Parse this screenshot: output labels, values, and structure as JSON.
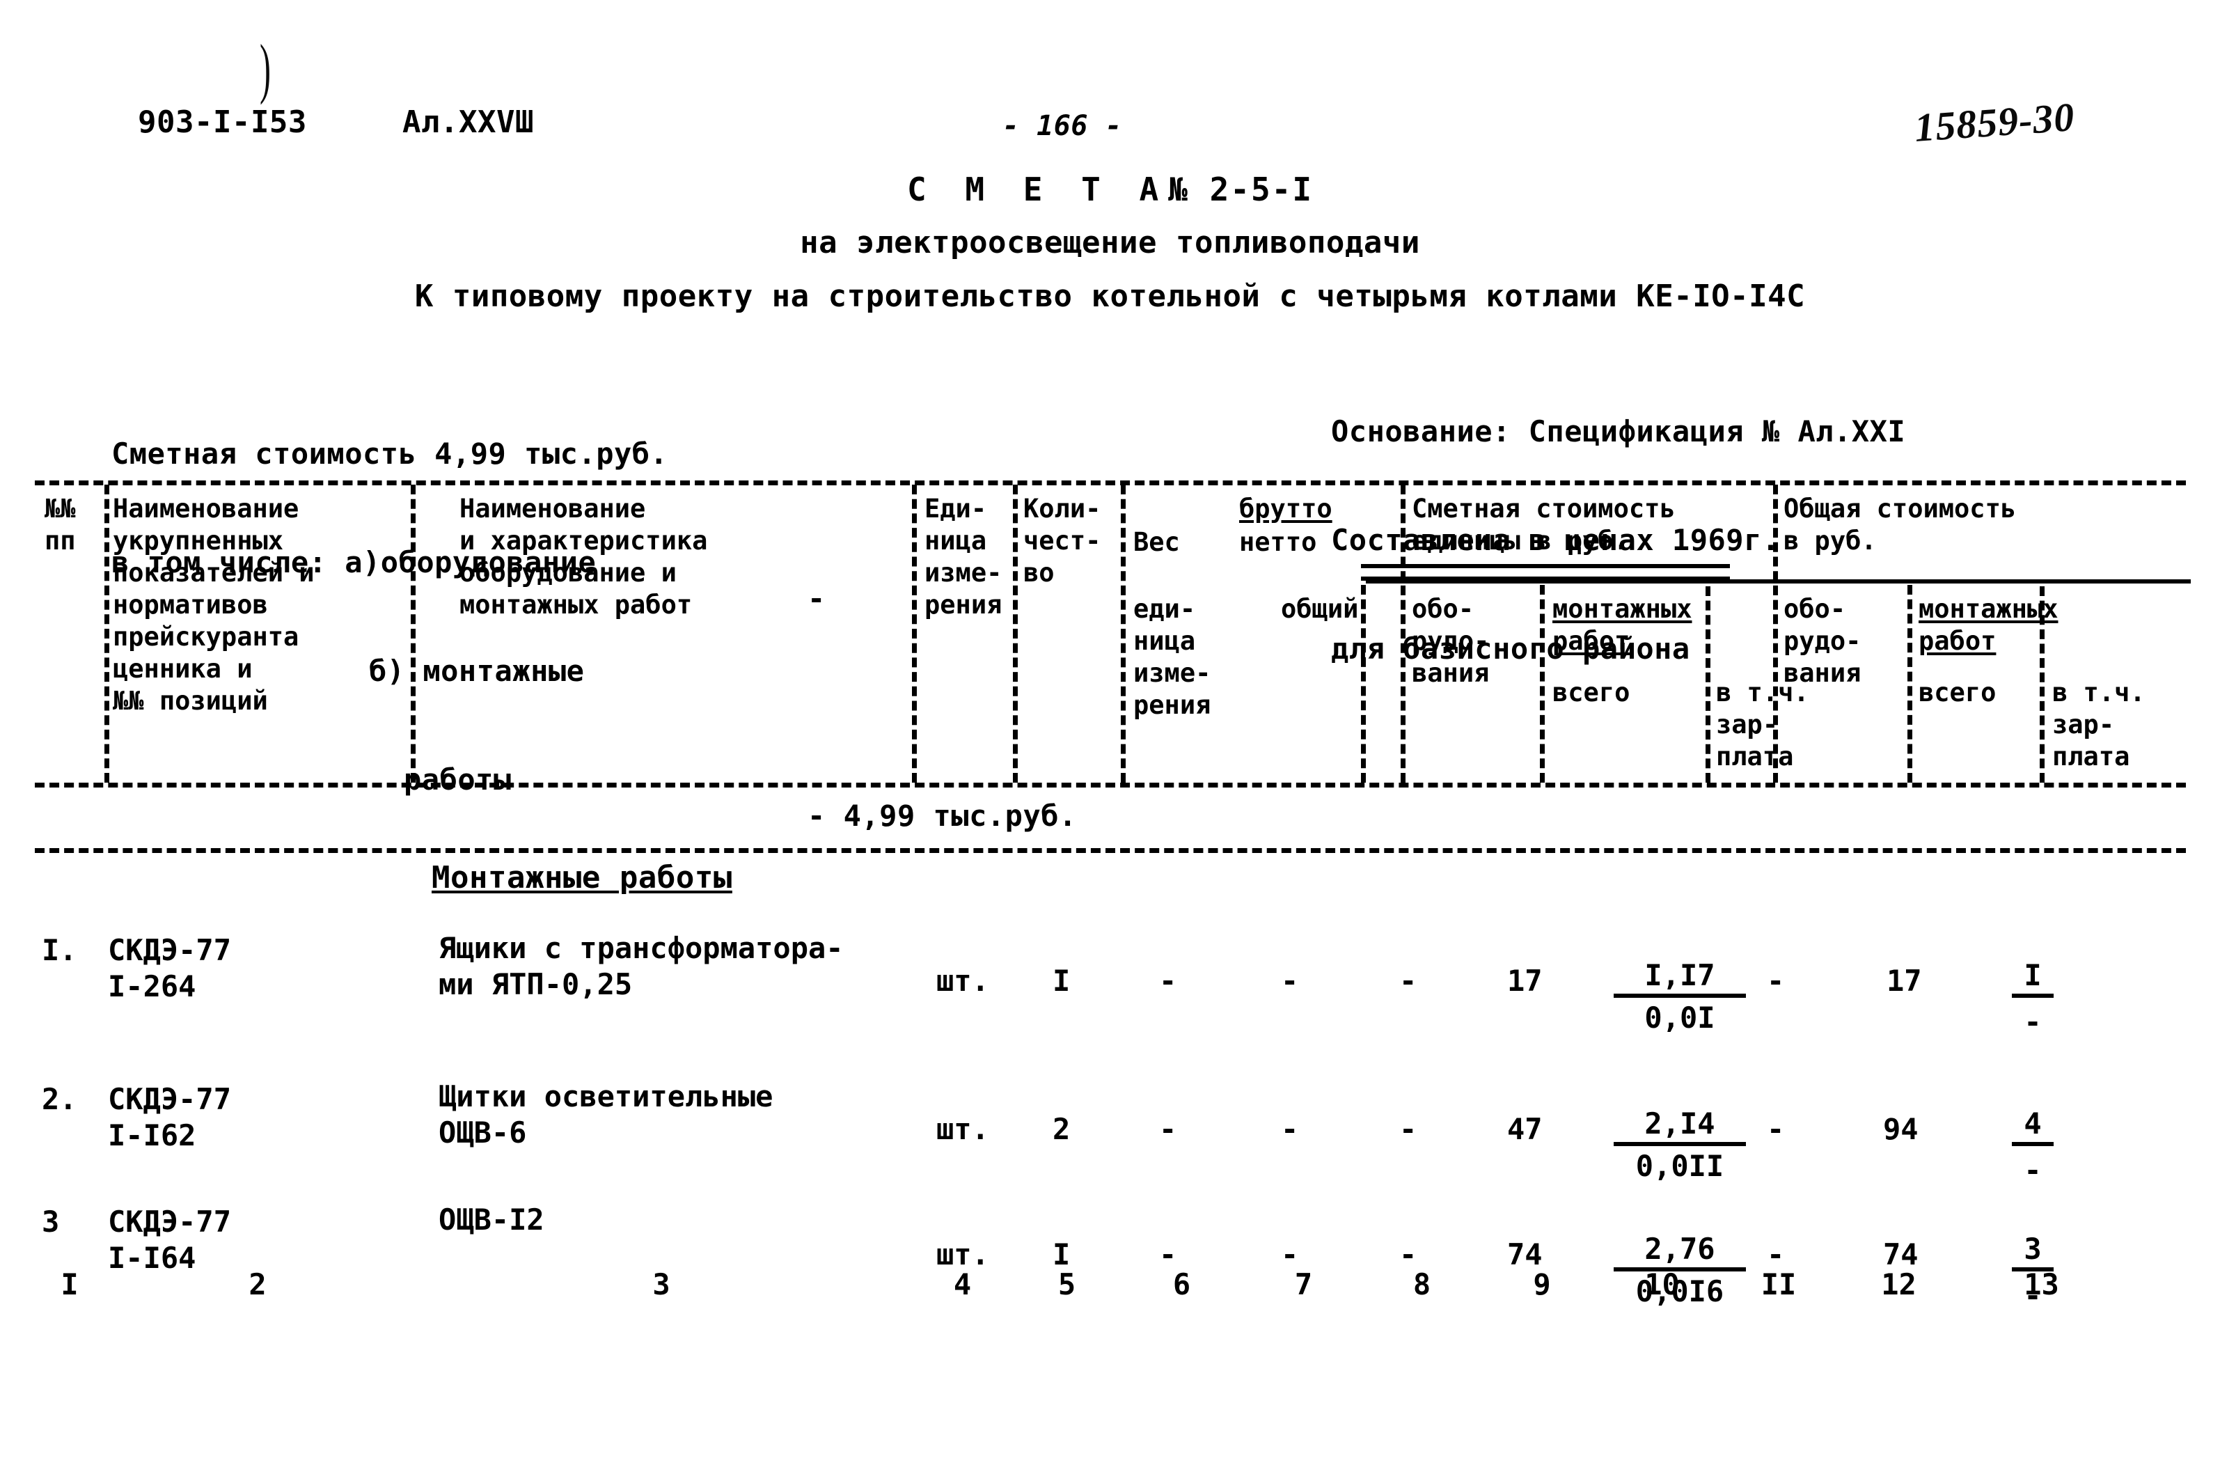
{
  "header": {
    "project_code": "903-I-I53",
    "album": "Ал.XXVШ",
    "page_number": "- 166 -",
    "archive_stamp": "15859-30"
  },
  "title": {
    "line1_label": "С М Е Т А",
    "line1_number": "№ 2-5-I",
    "line2": "на электроосвещение топливоподачи",
    "line3": "К типовому проекту на строительство котельной с четырьмя котлами КЕ-IО-I4С"
  },
  "summary_left": {
    "total_label": "Сметная стоимость 4,99 тыс.руб.",
    "breakdown_label": "в том числе: а)оборудование",
    "equipment_dash": "-",
    "install_label_1": "б) монтажные",
    "install_label_2": "работы",
    "install_dash": "-",
    "install_value": "4,99 тыс.руб."
  },
  "summary_right": {
    "basis": "Основание: Спецификация № Ал.XXI",
    "prices": "Составлена в ценах 1969г.",
    "region": "для базисного района"
  },
  "table": {
    "headers": {
      "col1": "№№\nпп",
      "col2": "Наименование\nукрупненных\nпоказателей и\nнормативов\nпрейскуранта\nценника и\n№№ позиций",
      "col3": "Наименование\nи характеристика\nоборудование и\nмонтажных работ",
      "col4": "Еди-\nница\nизме-\nрения",
      "col5": "Коли-\nчест-\nво",
      "weight_group_prefix": "Вес",
      "weight_group_num": "брутто",
      "weight_group_den": "нетто",
      "col6": "еди-\nница\nизме-\nрения",
      "col7": "общий",
      "unit_cost_group": "Сметная стоимость\nединицы в руб.",
      "col8": "обо-\nрудо-\nвания",
      "col9_10_group_num": "монтажных\nработ",
      "col9": "всего",
      "col10": "в т.ч.\nзар-\nплата",
      "total_cost_group": "Общая стоимость\nв руб.",
      "col11": "обо-\nрудо-\nвания",
      "col12_13_group_num": "монтажных\nработ",
      "col12": "всего",
      "col13": "в т.ч.\nзар-\nплата"
    },
    "column_numbers": [
      "I",
      "2",
      "3",
      "4",
      "5",
      "6",
      "7",
      "8",
      "9",
      "10",
      "II",
      "12",
      "13"
    ],
    "section_heading": "Монтажные работы",
    "rows": [
      {
        "no": "I.",
        "ref_line1": "СКДЭ-77",
        "ref_line2": "I-264",
        "name_line1": "Ящики с трансформатора-",
        "name_line2": "ми ЯТП-0,25",
        "unit": "шт.",
        "qty": "I",
        "weight_unit": "-",
        "weight_total": "-",
        "equip_unit_cost": "-",
        "install_total_unit": "17",
        "install_wage_num": "I,I7",
        "install_wage_den": "0,0I",
        "equip_total": "-",
        "install_total": "17",
        "wage_total_num": "I",
        "wage_total_den": "-"
      },
      {
        "no": "2.",
        "ref_line1": "СКДЭ-77",
        "ref_line2": "I-I62",
        "name_line1": "Щитки осветительные",
        "name_line2": "ОЩВ-6",
        "unit": "шт.",
        "qty": "2",
        "weight_unit": "-",
        "weight_total": "-",
        "equip_unit_cost": "-",
        "install_total_unit": "47",
        "install_wage_num": "2,I4",
        "install_wage_den": "0,0II",
        "equip_total": "-",
        "install_total": "94",
        "wage_total_num": "4",
        "wage_total_den": "-"
      },
      {
        "no": "3",
        "ref_line1": "СКДЭ-77",
        "ref_line2": "I-I64",
        "name_line1": "ОЩВ-I2",
        "name_line2": "",
        "unit": "шт.",
        "qty": "I",
        "weight_unit": "-",
        "weight_total": "-",
        "equip_unit_cost": "-",
        "install_total_unit": "74",
        "install_wage_num": "2,76",
        "install_wage_den": "0,0I6",
        "equip_total": "-",
        "install_total": "74",
        "wage_total_num": "3",
        "wage_total_den": "-"
      }
    ]
  }
}
